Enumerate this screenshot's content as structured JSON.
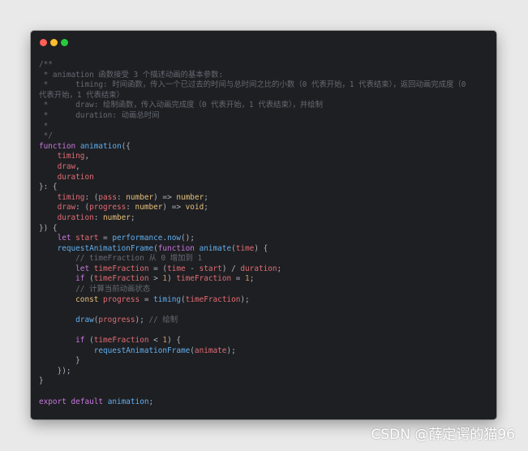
{
  "code": {
    "lines": [
      [
        [
          "c",
          "/**"
        ]
      ],
      [
        [
          "c",
          " * animation 函数接受 3 个描述动画的基本参数:"
        ]
      ],
      [
        [
          "c",
          " *      timing: 时间函数，传入一个已过去的时间与总时间之比的小数（0 代表开始，1 代表结束），返回动画完成度（0"
        ]
      ],
      [
        [
          "c",
          "代表开始，1 代表结束）"
        ]
      ],
      [
        [
          "c",
          " *      draw: 绘制函数，传入动画完成度（0 代表开始，1 代表结束），并绘制"
        ]
      ],
      [
        [
          "c",
          " *      duration: 动画总时间"
        ]
      ],
      [
        [
          "c",
          " *"
        ]
      ],
      [
        [
          "c",
          " */"
        ]
      ],
      [
        [
          "k",
          "function"
        ],
        [
          "p",
          " "
        ],
        [
          "fn",
          "animation"
        ],
        [
          "p",
          "({"
        ]
      ],
      [
        [
          "p",
          "    "
        ],
        [
          "v",
          "timing"
        ],
        [
          "p",
          ","
        ]
      ],
      [
        [
          "p",
          "    "
        ],
        [
          "v",
          "draw"
        ],
        [
          "p",
          ","
        ]
      ],
      [
        [
          "p",
          "    "
        ],
        [
          "v",
          "duration"
        ]
      ],
      [
        [
          "p",
          "}: {"
        ]
      ],
      [
        [
          "p",
          "    "
        ],
        [
          "v",
          "timing"
        ],
        [
          "p",
          ": ("
        ],
        [
          "v",
          "pass"
        ],
        [
          "p",
          ": "
        ],
        [
          "t",
          "number"
        ],
        [
          "p",
          ") => "
        ],
        [
          "t",
          "number"
        ],
        [
          "p",
          ";"
        ]
      ],
      [
        [
          "p",
          "    "
        ],
        [
          "v",
          "draw"
        ],
        [
          "p",
          ": ("
        ],
        [
          "v",
          "progress"
        ],
        [
          "p",
          ": "
        ],
        [
          "t",
          "number"
        ],
        [
          "p",
          ") => "
        ],
        [
          "t",
          "void"
        ],
        [
          "p",
          ";"
        ]
      ],
      [
        [
          "p",
          "    "
        ],
        [
          "v",
          "duration"
        ],
        [
          "p",
          ": "
        ],
        [
          "t",
          "number"
        ],
        [
          "p",
          ";"
        ]
      ],
      [
        [
          "p",
          "}) {"
        ]
      ],
      [
        [
          "p",
          "    "
        ],
        [
          "k",
          "let"
        ],
        [
          "p",
          " "
        ],
        [
          "v",
          "start"
        ],
        [
          "p",
          " = "
        ],
        [
          "fn",
          "performance"
        ],
        [
          "p",
          "."
        ],
        [
          "fn",
          "now"
        ],
        [
          "p",
          "();"
        ]
      ],
      [
        [
          "p",
          "    "
        ],
        [
          "fn",
          "requestAnimationFrame"
        ],
        [
          "p",
          "("
        ],
        [
          "k",
          "function"
        ],
        [
          "p",
          " "
        ],
        [
          "fn",
          "animate"
        ],
        [
          "p",
          "("
        ],
        [
          "v",
          "time"
        ],
        [
          "p",
          ") {"
        ]
      ],
      [
        [
          "p",
          "        "
        ],
        [
          "c",
          "// timeFraction 从 0 增加到 1"
        ]
      ],
      [
        [
          "p",
          "        "
        ],
        [
          "k",
          "let"
        ],
        [
          "p",
          " "
        ],
        [
          "v",
          "timeFraction"
        ],
        [
          "p",
          " = ("
        ],
        [
          "v",
          "time"
        ],
        [
          "p",
          " - "
        ],
        [
          "v",
          "start"
        ],
        [
          "p",
          ") / "
        ],
        [
          "v",
          "duration"
        ],
        [
          "p",
          ";"
        ]
      ],
      [
        [
          "p",
          "        "
        ],
        [
          "k",
          "if"
        ],
        [
          "p",
          " ("
        ],
        [
          "v",
          "timeFraction"
        ],
        [
          "p",
          " > "
        ],
        [
          "n",
          "1"
        ],
        [
          "p",
          ") "
        ],
        [
          "v",
          "timeFraction"
        ],
        [
          "p",
          " = "
        ],
        [
          "n",
          "1"
        ],
        [
          "p",
          ";"
        ]
      ],
      [
        [
          "p",
          "        "
        ],
        [
          "c",
          "// 计算当前动画状态"
        ]
      ],
      [
        [
          "p",
          "        "
        ],
        [
          "y",
          "const"
        ],
        [
          "p",
          " "
        ],
        [
          "v",
          "progress"
        ],
        [
          "p",
          " = "
        ],
        [
          "fn",
          "timing"
        ],
        [
          "p",
          "("
        ],
        [
          "v",
          "timeFraction"
        ],
        [
          "p",
          ");"
        ]
      ],
      [
        [
          "p",
          ""
        ]
      ],
      [
        [
          "p",
          "        "
        ],
        [
          "fn",
          "draw"
        ],
        [
          "p",
          "("
        ],
        [
          "v",
          "progress"
        ],
        [
          "p",
          "); "
        ],
        [
          "c",
          "// 绘制"
        ]
      ],
      [
        [
          "p",
          ""
        ]
      ],
      [
        [
          "p",
          "        "
        ],
        [
          "k",
          "if"
        ],
        [
          "p",
          " ("
        ],
        [
          "v",
          "timeFraction"
        ],
        [
          "p",
          " < "
        ],
        [
          "n",
          "1"
        ],
        [
          "p",
          ") {"
        ]
      ],
      [
        [
          "p",
          "            "
        ],
        [
          "fn",
          "requestAnimationFrame"
        ],
        [
          "p",
          "("
        ],
        [
          "v",
          "animate"
        ],
        [
          "p",
          ");"
        ]
      ],
      [
        [
          "p",
          "        }"
        ]
      ],
      [
        [
          "p",
          "    });"
        ]
      ],
      [
        [
          "p",
          "}"
        ]
      ],
      [
        [
          "p",
          ""
        ]
      ],
      [
        [
          "k",
          "export"
        ],
        [
          "p",
          " "
        ],
        [
          "k",
          "default"
        ],
        [
          "p",
          " "
        ],
        [
          "fn",
          "animation"
        ],
        [
          "p",
          ";"
        ]
      ]
    ]
  },
  "watermark": "CSDN @薛定谔的猫96"
}
